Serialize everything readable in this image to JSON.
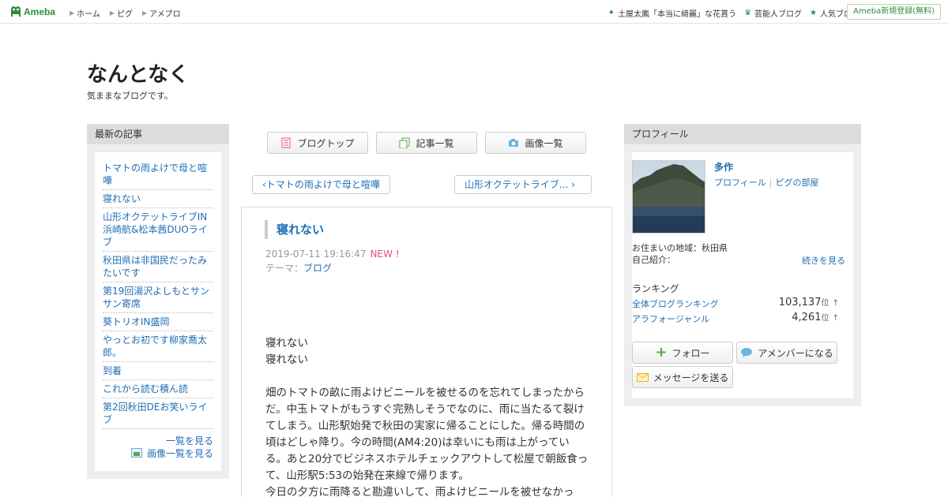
{
  "header": {
    "logo": "Ameba",
    "nav": [
      "ホーム",
      "ピグ",
      "アメブロ"
    ],
    "right_links": [
      {
        "icon": "sparkle-icon",
        "label": "土屋太鳳「本当に綺麗」な花貰う"
      },
      {
        "icon": "crown-icon",
        "label": "芸能人ブログ"
      },
      {
        "icon": "star-icon",
        "label": "人気ブログ"
      }
    ],
    "register": "Ameba新規登録(無料)"
  },
  "blog": {
    "title": "なんとなく",
    "description": "気ままなブログです。"
  },
  "recent": {
    "heading": "最新の記事",
    "items": [
      "トマトの雨よけで母と喧嘩",
      "寝れない",
      "山形オクテットライブIN浜崎航&松本茜DUOライブ",
      "秋田県は非国民だったみたいです",
      "第19回湯沢よしもとサンサン寄席",
      "葵トリオIN盛岡",
      "やっとお初です柳家喬太郎。",
      "到着",
      "これから読む積ん読",
      "第2回秋田DEお笑いライブ"
    ],
    "see_all": "一覧を見る",
    "see_images": "画像一覧を見る"
  },
  "buttons": {
    "blog_top": "ブログトップ",
    "entry_list": "記事一覧",
    "image_list": "画像一覧"
  },
  "pager": {
    "prev": "トマトの雨よけで母と喧嘩",
    "next": "山形オクテットライブ..."
  },
  "article": {
    "title": "寝れない",
    "date": "2019-07-11 19:16:47",
    "new_badge": "NEW !",
    "theme_label": "テーマ：",
    "theme": "ブログ",
    "body": [
      "寝れない",
      "寝れない",
      "",
      "畑のトマトの畝に雨よけビニールを被せるのを忘れてしまったからだ。中玉トマトがもうすぐ完熟しそうでなのに、雨に当たるて裂けてしまう。山形駅始発で秋田の実家に帰ることにした。帰る時間の頃はどしゃ降り。今の時間(AM4:20)は幸いにも雨は上がっている。あと20分でビジネスホテルチェックアウトして松屋で朝飯食って、山形駅5:53の始発在来線で帰ります。",
      "今日の夕方に雨降ると勘違いして、雨よけビニールを被せなかっ"
    ]
  },
  "profile": {
    "heading": "プロフィール",
    "name": "多作",
    "link_profile": "プロフィール",
    "link_pig": "ピグの部屋",
    "residence": "お住まいの地域：秋田県",
    "intro_label": "自己紹介：",
    "read_more": "続きを見る",
    "ranking_heading": "ランキング",
    "rankings": [
      {
        "label": "全体ブログランキング",
        "value": "103,137",
        "unit": "位",
        "arrow": "↑"
      },
      {
        "label": "アラフォージャンル",
        "value": "4,261",
        "unit": "位",
        "arrow": "↑"
      }
    ],
    "follow": "フォロー",
    "amember": "アメンバーになる",
    "message": "メッセージを送る"
  }
}
